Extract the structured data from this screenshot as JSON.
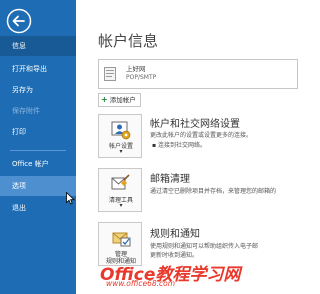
{
  "nav": {
    "items": [
      {
        "label": "信息",
        "state": "active"
      },
      {
        "label": "打开和导出",
        "state": "normal"
      },
      {
        "label": "另存为",
        "state": "normal"
      },
      {
        "label": "保存附件",
        "state": "disabled"
      },
      {
        "label": "打印",
        "state": "normal"
      },
      {
        "label": "Office 帐户",
        "state": "normal"
      },
      {
        "label": "选项",
        "state": "hover"
      },
      {
        "label": "退出",
        "state": "normal"
      }
    ]
  },
  "main": {
    "title": "帐户信息",
    "account": {
      "name": "上好网",
      "type": "POP/SMTP",
      "dropdown": "▾"
    },
    "add_account_label": "添加帐户",
    "sections": [
      {
        "button_label": "帐户设置",
        "button_label2": "▾",
        "title": "帐户和社交网络设置",
        "description": "更改此帐户的设置或设置更多的连接。",
        "link": "连接到社交网络。"
      },
      {
        "button_label": "清理工具",
        "button_label2": "▾",
        "title": "邮箱清理",
        "description": "通过清空已删除项目并存档，来管理您的邮箱的"
      },
      {
        "button_label": "管理",
        "button_label2": "规则和通知",
        "title": "规则和通知",
        "description": "使用规则和通知可以帮助组织传入电子邮",
        "description2": "更新时收到通知。"
      }
    ]
  },
  "watermark": {
    "main": "Office教程学习网",
    "sub": "www.office68.com"
  },
  "colors": {
    "nav_bg": "#1e6cb4",
    "nav_active": "#185a96",
    "nav_hover": "#4e8fd0",
    "watermark": "#e8392c"
  }
}
